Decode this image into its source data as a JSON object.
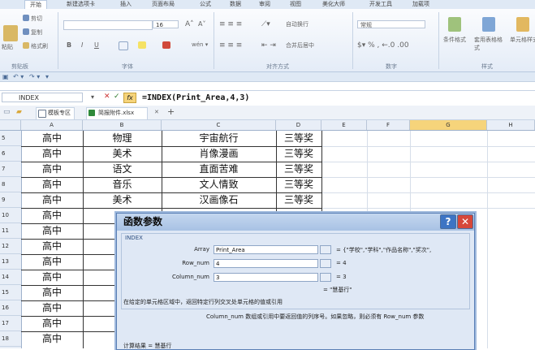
{
  "ribbon": {
    "tabs": [
      "开始",
      "新建选项卡",
      "插入",
      "页面布局",
      "公式",
      "数据",
      "审阅",
      "视图",
      "美化大师",
      "开发工具",
      "加载项"
    ],
    "active_tab": "开始",
    "clipboard": {
      "paste": "粘贴",
      "cut": "剪切",
      "copy": "复制",
      "format_painter": "格式刷",
      "label": "剪贴板"
    },
    "font": {
      "size": "16",
      "bold": "B",
      "italic": "I",
      "underline": "U",
      "label": "字体"
    },
    "alignment": {
      "wrap": "自动换行",
      "merge": "合并后居中",
      "label": "对齐方式"
    },
    "number": {
      "format": "常规",
      "label": "数字"
    },
    "styles": {
      "conditional": "条件格式",
      "table": "套用表格格式",
      "cell": "单元格样式",
      "label": "样式"
    }
  },
  "formula_bar": {
    "name_box": "INDEX",
    "fx": "fx",
    "formula": "=INDEX(Print_Area,4,3)"
  },
  "doc_tabs": [
    "模板专区",
    "简报附件.xlsx"
  ],
  "grid": {
    "columns": [
      "A",
      "B",
      "C",
      "D",
      "E",
      "F",
      "G",
      "H"
    ],
    "rows": [
      {
        "num": "5",
        "a": "高中",
        "b": "物理",
        "c": "宇宙航行",
        "d": "三等奖"
      },
      {
        "num": "6",
        "a": "高中",
        "b": "美术",
        "c": "肖像漫画",
        "d": "三等奖"
      },
      {
        "num": "7",
        "a": "高中",
        "b": "语文",
        "c": "直面苦难",
        "d": "三等奖"
      },
      {
        "num": "8",
        "a": "高中",
        "b": "音乐",
        "c": "文人情致",
        "d": "三等奖"
      },
      {
        "num": "9",
        "a": "高中",
        "b": "美术",
        "c": "汉画像石",
        "d": "三等奖"
      },
      {
        "num": "10",
        "a": "高中",
        "b": "",
        "c": "",
        "d": ""
      },
      {
        "num": "11",
        "a": "高中",
        "b": "",
        "c": "",
        "d": ""
      },
      {
        "num": "12",
        "a": "高中",
        "b": "",
        "c": "",
        "d": ""
      },
      {
        "num": "13",
        "a": "高中",
        "b": "",
        "c": "",
        "d": ""
      },
      {
        "num": "14",
        "a": "高中",
        "b": "",
        "c": "",
        "d": ""
      },
      {
        "num": "15",
        "a": "高中",
        "b": "",
        "c": "",
        "d": ""
      },
      {
        "num": "16",
        "a": "高中",
        "b": "",
        "c": "",
        "d": ""
      },
      {
        "num": "17",
        "a": "高中",
        "b": "",
        "c": "",
        "d": ""
      },
      {
        "num": "18",
        "a": "高中",
        "b": "",
        "c": "",
        "d": ""
      }
    ]
  },
  "dialog": {
    "title": "函数参数",
    "help": "?",
    "close": "✕",
    "function_name": "INDEX",
    "args": [
      {
        "label": "Array",
        "value": "Print_Area",
        "result": "= {\"学校\",\"学科\",\"作品名称\",\"奖次\","
      },
      {
        "label": "Row_num",
        "value": "4",
        "result": "= 4"
      },
      {
        "label": "Column_num",
        "value": "3",
        "result": "= 3"
      }
    ],
    "overall_result": "= \"慧基行\"",
    "description": "在给定的单元格区域中，返回特定行列交叉处单元格的值或引用",
    "arg_help": "Column_num  数组或引用中要返回值的列序号。如果忽略，则必须有 Row_num 参数",
    "footer": "计算结果 = 慧基行"
  },
  "colors": {
    "accent": "#f6d47b",
    "dialog_close": "#d6483a",
    "dialog_help": "#3d74c4"
  }
}
